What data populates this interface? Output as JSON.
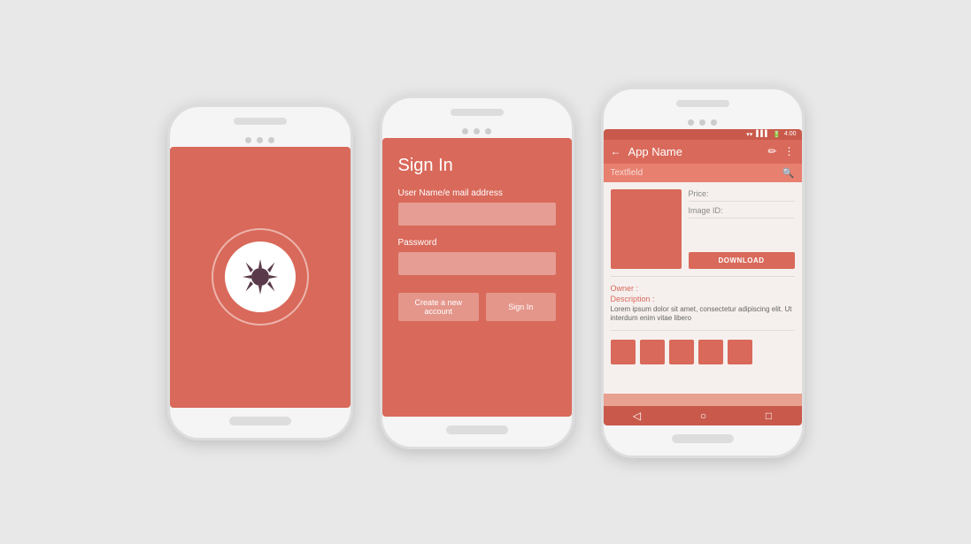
{
  "scene": {
    "background": "#e8e8e8"
  },
  "phone1": {
    "type": "splash",
    "logo_alt": "sun-compass icon"
  },
  "phone2": {
    "type": "signin",
    "title": "Sign In",
    "username_label": "User Name/e mail address",
    "password_label": "Password",
    "create_account_btn": "Create a new account",
    "signin_btn": "Sign In"
  },
  "phone3": {
    "type": "app",
    "status_time": "4:00",
    "app_name": "App Name",
    "search_placeholder": "Textfield",
    "price_label": "Price:",
    "image_id_label": "Image ID:",
    "download_btn": "DOWNLOAD",
    "owner_label": "Owner :",
    "description_label": "Description :",
    "lorem_text": "Lorem ipsum dolor sit amet, consectetur adipiscing elit. Ut interdum enim vitae libero"
  }
}
